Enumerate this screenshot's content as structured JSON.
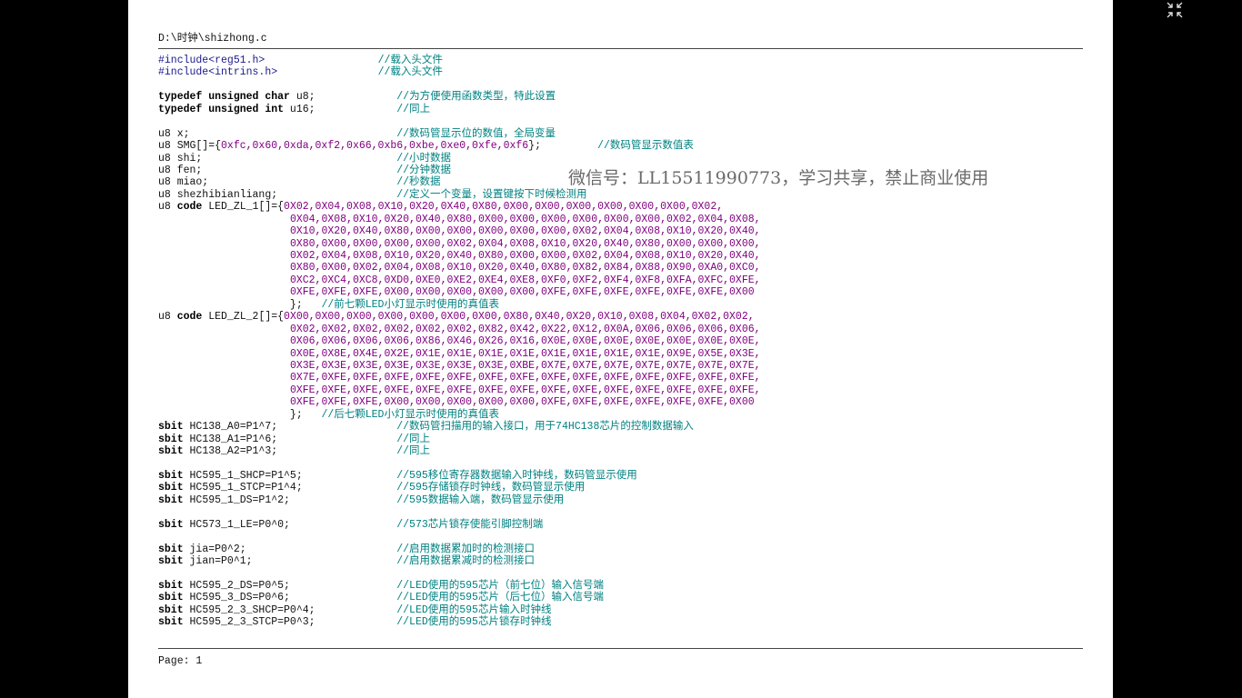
{
  "file_path": "D:\\时钟\\shizhong.c",
  "footer": "Page: 1",
  "watermark": "微信号：LL15511990773，学习共享，禁止商业使用",
  "icons": {
    "exit_fullscreen": "exit-fullscreen-icon"
  },
  "lines": [
    [
      {
        "t": "#include",
        "c": "pp"
      },
      {
        "t": "<reg51.h>                  ",
        "c": "pp"
      },
      {
        "t": "//载入头文件",
        "c": "cm"
      }
    ],
    [
      {
        "t": "#include",
        "c": "pp"
      },
      {
        "t": "<intrins.h>                ",
        "c": "pp"
      },
      {
        "t": "//载入头文件",
        "c": "cm"
      }
    ],
    [],
    [
      {
        "t": "typedef unsigned char",
        "c": "kw"
      },
      {
        "t": " u8;             ",
        "c": ""
      },
      {
        "t": "//为方便使用函数类型，特此设置",
        "c": "cm"
      }
    ],
    [
      {
        "t": "typedef unsigned int",
        "c": "kw"
      },
      {
        "t": " u16;             ",
        "c": ""
      },
      {
        "t": "//同上",
        "c": "cm"
      }
    ],
    [],
    [
      {
        "t": "u8 x;                                 ",
        "c": ""
      },
      {
        "t": "//数码管显示位的数值，全局变量",
        "c": "cm"
      }
    ],
    [
      {
        "t": "u8 SMG[]={",
        "c": ""
      },
      {
        "t": "0xfc,0x60,0xda,0xf2,0x66,0xb6,0xbe,0xe0,0xfe,0xf6",
        "c": "num"
      },
      {
        "t": "};         ",
        "c": ""
      },
      {
        "t": "//数码管显示数值表",
        "c": "cm"
      }
    ],
    [
      {
        "t": "u8 shi;                               ",
        "c": ""
      },
      {
        "t": "//小时数据",
        "c": "cm"
      }
    ],
    [
      {
        "t": "u8 fen;                               ",
        "c": ""
      },
      {
        "t": "//分钟数据",
        "c": "cm"
      }
    ],
    [
      {
        "t": "u8 miao;                              ",
        "c": ""
      },
      {
        "t": "//秒数据",
        "c": "cm"
      }
    ],
    [
      {
        "t": "u8 shezhibianliang;                   ",
        "c": ""
      },
      {
        "t": "//定义一个变量，设置键按下时候检测用",
        "c": "cm"
      }
    ],
    [
      {
        "t": "u8 ",
        "c": ""
      },
      {
        "t": "code",
        "c": "kw"
      },
      {
        "t": " LED_ZL_1[]={",
        "c": ""
      },
      {
        "t": "0X02,0X04,0X08,0X10,0X20,0X40,0X80,0X00,0X00,0X00,0X00,0X00,0X00,0X02,",
        "c": "num"
      }
    ],
    [
      {
        "t": "                     ",
        "c": ""
      },
      {
        "t": "0X04,0X08,0X10,0X20,0X40,0X80,0X00,0X00,0X00,0X00,0X00,0X00,0X02,0X04,0X08,",
        "c": "num"
      }
    ],
    [
      {
        "t": "                     ",
        "c": ""
      },
      {
        "t": "0X10,0X20,0X40,0X80,0X00,0X00,0X00,0X00,0X00,0X02,0X04,0X08,0X10,0X20,0X40,",
        "c": "num"
      }
    ],
    [
      {
        "t": "                     ",
        "c": ""
      },
      {
        "t": "0X80,0X00,0X00,0X00,0X00,0X02,0X04,0X08,0X10,0X20,0X40,0X80,0X00,0X00,0X00,",
        "c": "num"
      }
    ],
    [
      {
        "t": "                     ",
        "c": ""
      },
      {
        "t": "0X02,0X04,0X08,0X10,0X20,0X40,0X80,0X00,0X00,0X02,0X04,0X08,0X10,0X20,0X40,",
        "c": "num"
      }
    ],
    [
      {
        "t": "                     ",
        "c": ""
      },
      {
        "t": "0X80,0X00,0X02,0X04,0X08,0X10,0X20,0X40,0X80,0X82,0X84,0X88,0X90,0XA0,0XC0,",
        "c": "num"
      }
    ],
    [
      {
        "t": "                     ",
        "c": ""
      },
      {
        "t": "0XC2,0XC4,0XC8,0XD0,0XE0,0XE2,0XE4,0XE8,0XF0,0XF2,0XF4,0XF8,0XFA,0XFC,0XFE,",
        "c": "num"
      }
    ],
    [
      {
        "t": "                     ",
        "c": ""
      },
      {
        "t": "0XFE,0XFE,0XFE,0X00,0X00,0X00,0X00,0X00,0XFE,0XFE,0XFE,0XFE,0XFE,0XFE,0X00",
        "c": "num"
      }
    ],
    [
      {
        "t": "                     };   ",
        "c": ""
      },
      {
        "t": "//前七颗LED小灯显示时使用的真值表",
        "c": "cm"
      }
    ],
    [
      {
        "t": "u8 ",
        "c": ""
      },
      {
        "t": "code",
        "c": "kw"
      },
      {
        "t": " LED_ZL_2[]={",
        "c": ""
      },
      {
        "t": "0X00,0X00,0X00,0X00,0X00,0X00,0X00,0X80,0X40,0X20,0X10,0X08,0X04,0X02,0X02,",
        "c": "num"
      }
    ],
    [
      {
        "t": "                     ",
        "c": ""
      },
      {
        "t": "0X02,0X02,0X02,0X02,0X02,0X02,0X82,0X42,0X22,0X12,0X0A,0X06,0X06,0X06,0X06,",
        "c": "num"
      }
    ],
    [
      {
        "t": "                     ",
        "c": ""
      },
      {
        "t": "0X06,0X06,0X06,0X06,0X86,0X46,0X26,0X16,0X0E,0X0E,0X0E,0X0E,0X0E,0X0E,0X0E,",
        "c": "num"
      }
    ],
    [
      {
        "t": "                     ",
        "c": ""
      },
      {
        "t": "0X0E,0X8E,0X4E,0X2E,0X1E,0X1E,0X1E,0X1E,0X1E,0X1E,0X1E,0X1E,0X9E,0X5E,0X3E,",
        "c": "num"
      }
    ],
    [
      {
        "t": "                     ",
        "c": ""
      },
      {
        "t": "0X3E,0X3E,0X3E,0X3E,0X3E,0X3E,0X3E,0XBE,0X7E,0X7E,0X7E,0X7E,0X7E,0X7E,0X7E,",
        "c": "num"
      }
    ],
    [
      {
        "t": "                     ",
        "c": ""
      },
      {
        "t": "0X7E,0XFE,0XFE,0XFE,0XFE,0XFE,0XFE,0XFE,0XFE,0XFE,0XFE,0XFE,0XFE,0XFE,0XFE,",
        "c": "num"
      }
    ],
    [
      {
        "t": "                     ",
        "c": ""
      },
      {
        "t": "0XFE,0XFE,0XFE,0XFE,0XFE,0XFE,0XFE,0XFE,0XFE,0XFE,0XFE,0XFE,0XFE,0XFE,0XFE,",
        "c": "num"
      }
    ],
    [
      {
        "t": "                     ",
        "c": ""
      },
      {
        "t": "0XFE,0XFE,0XFE,0X00,0X00,0X00,0X00,0X00,0XFE,0XFE,0XFE,0XFE,0XFE,0XFE,0X00",
        "c": "num"
      }
    ],
    [
      {
        "t": "                     };   ",
        "c": ""
      },
      {
        "t": "//后七颗LED小灯显示时使用的真值表",
        "c": "cm"
      }
    ],
    [
      {
        "t": "sbit",
        "c": "kw"
      },
      {
        "t": " HC138_A0=P1^7;                   ",
        "c": ""
      },
      {
        "t": "//数码管扫描用的输入接口，用于74HC138芯片的控制数据输入",
        "c": "cm"
      }
    ],
    [
      {
        "t": "sbit",
        "c": "kw"
      },
      {
        "t": " HC138_A1=P1^6;                   ",
        "c": ""
      },
      {
        "t": "//同上",
        "c": "cm"
      }
    ],
    [
      {
        "t": "sbit",
        "c": "kw"
      },
      {
        "t": " HC138_A2=P1^3;                   ",
        "c": ""
      },
      {
        "t": "//同上",
        "c": "cm"
      }
    ],
    [],
    [
      {
        "t": "sbit",
        "c": "kw"
      },
      {
        "t": " HC595_1_SHCP=P1^5;               ",
        "c": ""
      },
      {
        "t": "//595移位寄存器数据输入时钟线，数码管显示使用",
        "c": "cm"
      }
    ],
    [
      {
        "t": "sbit",
        "c": "kw"
      },
      {
        "t": " HC595_1_STCP=P1^4;               ",
        "c": ""
      },
      {
        "t": "//595存储锁存时钟线，数码管显示使用",
        "c": "cm"
      }
    ],
    [
      {
        "t": "sbit",
        "c": "kw"
      },
      {
        "t": " HC595_1_DS=P1^2;                 ",
        "c": ""
      },
      {
        "t": "//595数据输入端，数码管显示使用",
        "c": "cm"
      }
    ],
    [],
    [
      {
        "t": "sbit",
        "c": "kw"
      },
      {
        "t": " HC573_1_LE=P0^0;                 ",
        "c": ""
      },
      {
        "t": "//573芯片锁存使能引脚控制端",
        "c": "cm"
      }
    ],
    [],
    [
      {
        "t": "sbit",
        "c": "kw"
      },
      {
        "t": " jia=P0^2;                        ",
        "c": ""
      },
      {
        "t": "//启用数据累加时的检测接口",
        "c": "cm"
      }
    ],
    [
      {
        "t": "sbit",
        "c": "kw"
      },
      {
        "t": " jian=P0^1;                       ",
        "c": ""
      },
      {
        "t": "//启用数据累减时的检测接口",
        "c": "cm"
      }
    ],
    [],
    [
      {
        "t": "sbit",
        "c": "kw"
      },
      {
        "t": " HC595_2_DS=P0^5;                 ",
        "c": ""
      },
      {
        "t": "//LED使用的595芯片（前七位）输入信号端",
        "c": "cm"
      }
    ],
    [
      {
        "t": "sbit",
        "c": "kw"
      },
      {
        "t": " HC595_3_DS=P0^6;                 ",
        "c": ""
      },
      {
        "t": "//LED使用的595芯片（后七位）输入信号端",
        "c": "cm"
      }
    ],
    [
      {
        "t": "sbit",
        "c": "kw"
      },
      {
        "t": " HC595_2_3_SHCP=P0^4;             ",
        "c": ""
      },
      {
        "t": "//LED使用的595芯片输入时钟线",
        "c": "cm"
      }
    ],
    [
      {
        "t": "sbit",
        "c": "kw"
      },
      {
        "t": " HC595_2_3_STCP=P0^3;             ",
        "c": ""
      },
      {
        "t": "//LED使用的595芯片锁存时钟线",
        "c": "cm"
      }
    ]
  ]
}
